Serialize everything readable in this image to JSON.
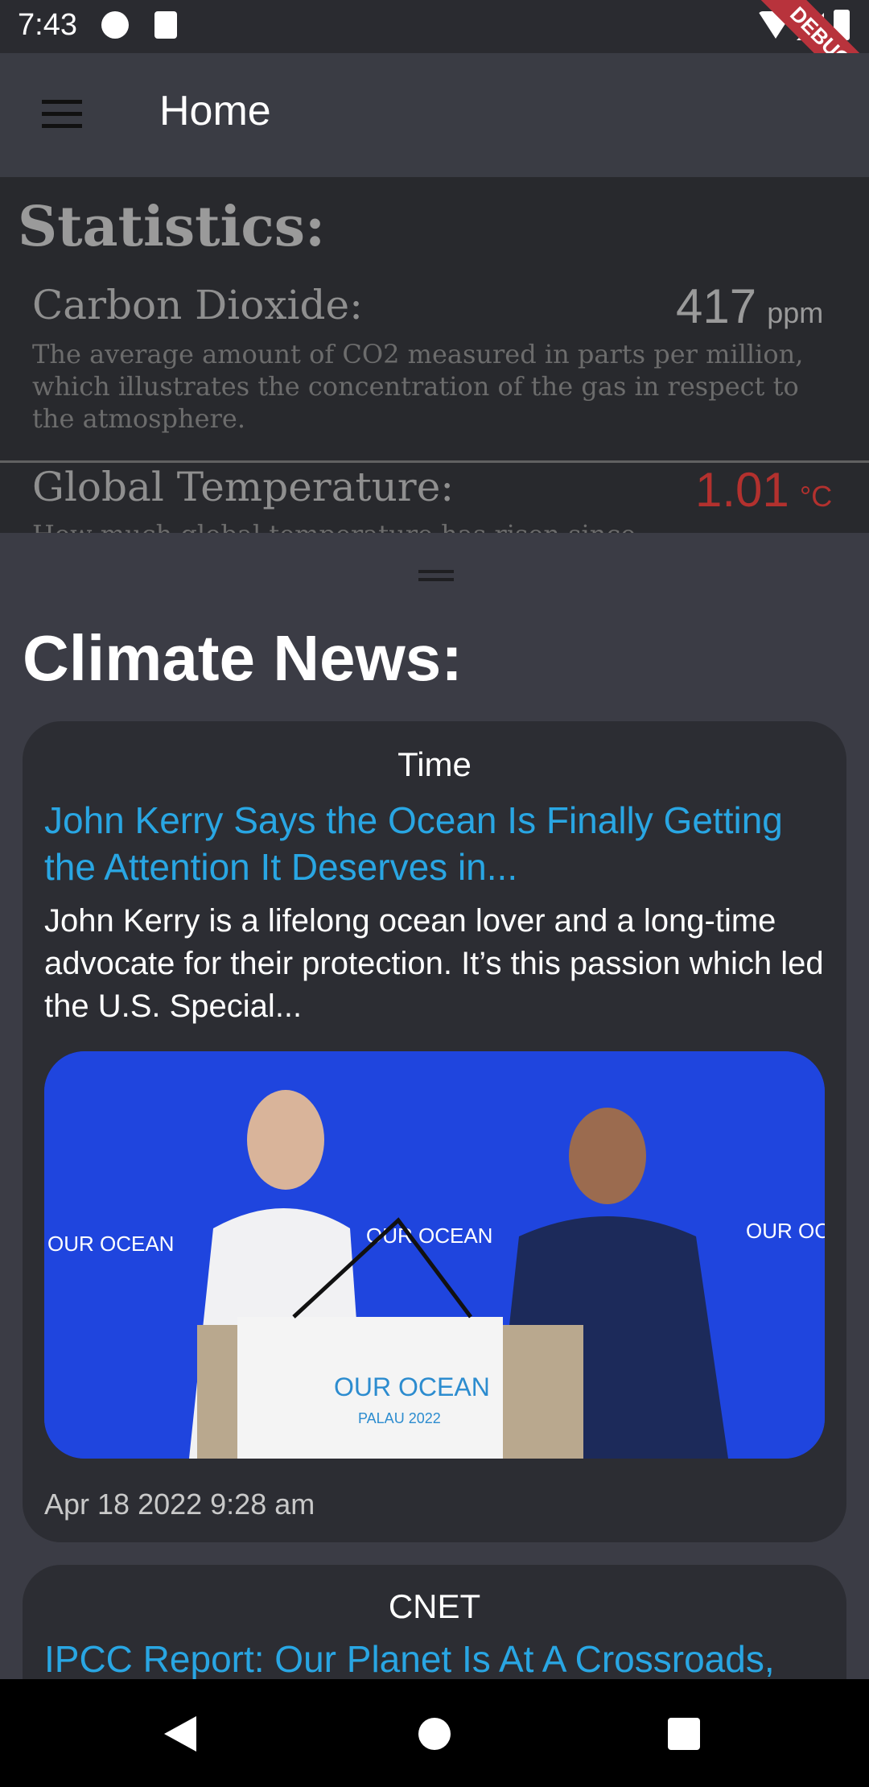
{
  "status_bar": {
    "time": "7:43",
    "debug_label": "DEBUG"
  },
  "app_bar": {
    "title": "Home"
  },
  "statistics": {
    "title": "Statistics:",
    "items": [
      {
        "label": "Carbon Dioxide:",
        "value": "417",
        "unit": "ppm",
        "description": "The average amount of CO2 measured in parts per million, which illustrates the concentration of the gas in respect to the atmosphere.",
        "value_color": "#9a9a9a"
      },
      {
        "label": "Global Temperature:",
        "value": "1.01",
        "unit": "°C",
        "description": "How much global temperature has risen since preindustrial",
        "value_color": "#b3312e"
      }
    ]
  },
  "news": {
    "title": "Climate News:",
    "articles": [
      {
        "source": "Time",
        "headline": "John Kerry Says the Ocean Is Finally Getting the Attention It Deserves in...",
        "description": "John Kerry is a lifelong ocean lover and a long-time advocate for their protection. It’s this passion which led the U.S. Special...",
        "image_caption": "OUR OCEAN",
        "image_subcaption": "PALAU 2022",
        "date": "Apr 18 2022 9:28 am"
      },
      {
        "source": "CNET",
        "headline": "IPCC Report: Our Planet Is At A Crossroads,"
      }
    ]
  },
  "colors": {
    "accent_link": "#29a6e3",
    "temperature_red": "#b3312e",
    "card_bg": "#2c2d33"
  }
}
